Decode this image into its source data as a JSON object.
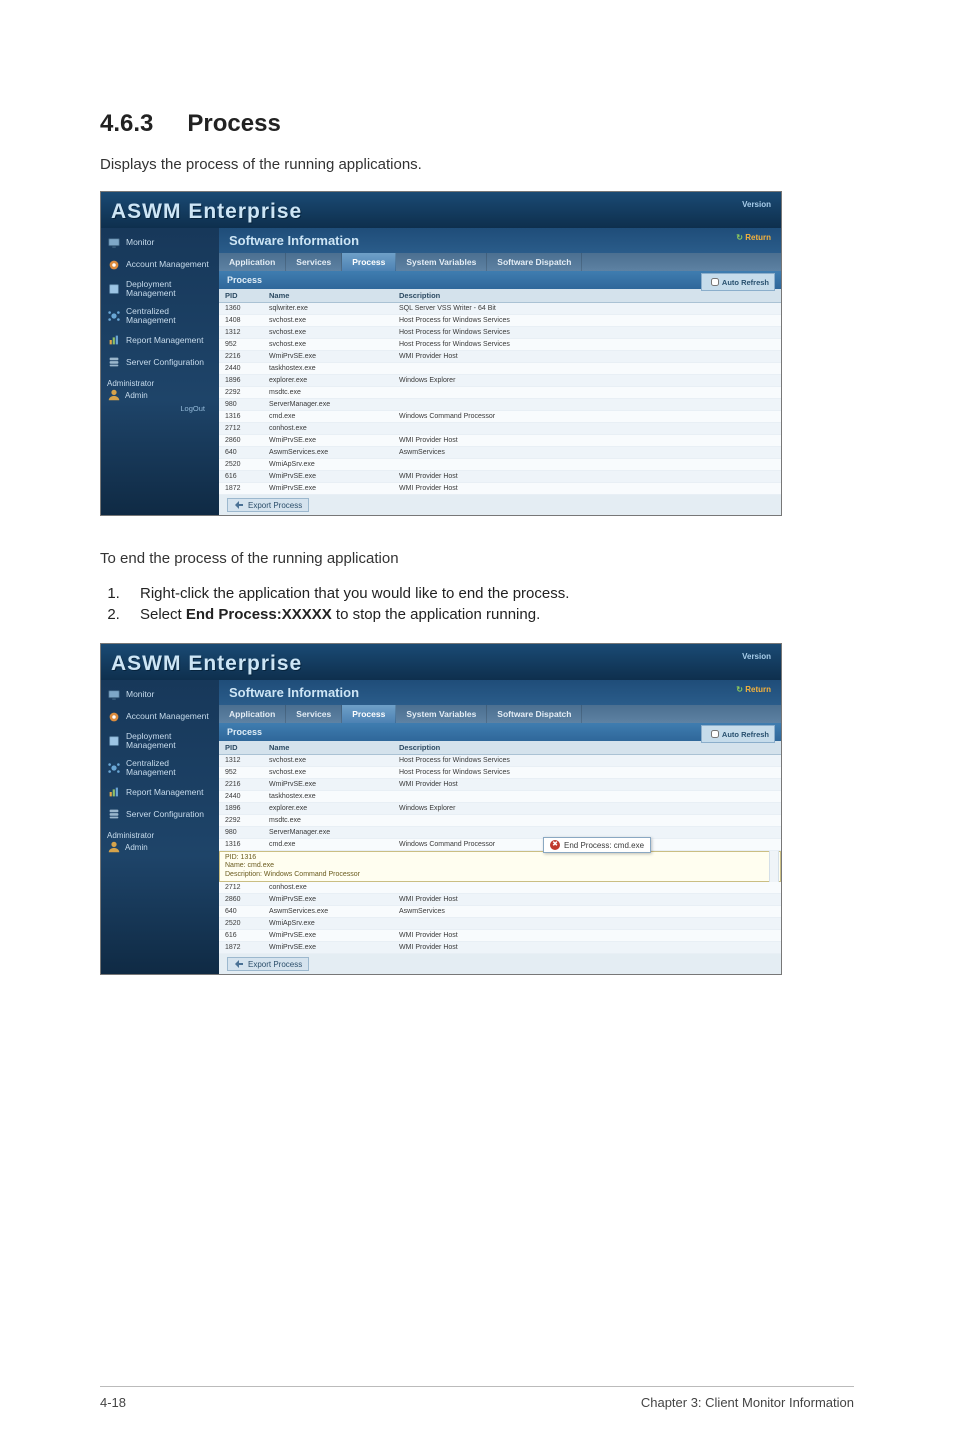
{
  "doc": {
    "section_number": "4.6.3",
    "section_title": "Process",
    "intro1": "Displays the process of the running applications.",
    "intro2": "To end the process of the running application",
    "step1": "Right-click the application that you would like to end the process.",
    "step2_a": "Select ",
    "step2_b": "End Process:XXXXX",
    "step2_c": " to stop the application running.",
    "page_left": "4-18",
    "page_right": "Chapter 3: Client Monitor Information"
  },
  "app": {
    "title": "ASWM Enterprise",
    "version_label": "Version",
    "main_section": "Software Information",
    "return_label": "Return",
    "tabs": {
      "application": "Application",
      "services": "Services",
      "process": "Process",
      "sysvars": "System Variables",
      "dispatch": "Software Dispatch"
    },
    "panel_title": "Process",
    "auto_refresh": "Auto Refresh",
    "headers": {
      "pid": "PID",
      "name": "Name",
      "desc": "Description"
    },
    "export_button": "Export Process",
    "nav": {
      "monitor": "Monitor",
      "account": "Account Management",
      "deploy": "Deployment Management",
      "central": "Centralized Management",
      "report": "Report Management",
      "server": "Server Configuration",
      "admin_label": "Administrator",
      "admin_user": "Admin",
      "logout": "LogOut"
    }
  },
  "shot1_rows": [
    {
      "pid": "1360",
      "name": "sqlwriter.exe",
      "desc": "SQL Server VSS Writer - 64 Bit"
    },
    {
      "pid": "1408",
      "name": "svchost.exe",
      "desc": "Host Process for Windows Services"
    },
    {
      "pid": "1312",
      "name": "svchost.exe",
      "desc": "Host Process for Windows Services"
    },
    {
      "pid": "952",
      "name": "svchost.exe",
      "desc": "Host Process for Windows Services"
    },
    {
      "pid": "2216",
      "name": "WmiPrvSE.exe",
      "desc": "WMI Provider Host"
    },
    {
      "pid": "2440",
      "name": "taskhostex.exe",
      "desc": ""
    },
    {
      "pid": "1896",
      "name": "explorer.exe",
      "desc": "Windows Explorer"
    },
    {
      "pid": "2292",
      "name": "msdtc.exe",
      "desc": ""
    },
    {
      "pid": "980",
      "name": "ServerManager.exe",
      "desc": ""
    },
    {
      "pid": "1316",
      "name": "cmd.exe",
      "desc": "Windows Command Processor"
    },
    {
      "pid": "2712",
      "name": "conhost.exe",
      "desc": ""
    },
    {
      "pid": "2860",
      "name": "WmiPrvSE.exe",
      "desc": "WMI Provider Host"
    },
    {
      "pid": "640",
      "name": "AswmServices.exe",
      "desc": "AswmServices"
    },
    {
      "pid": "2520",
      "name": "WmiApSrv.exe",
      "desc": ""
    },
    {
      "pid": "616",
      "name": "WmiPrvSE.exe",
      "desc": "WMI Provider Host"
    },
    {
      "pid": "1872",
      "name": "WmiPrvSE.exe",
      "desc": "WMI Provider Host"
    }
  ],
  "shot2_rows": [
    {
      "pid": "1312",
      "name": "svchost.exe",
      "desc": "Host Process for Windows Services"
    },
    {
      "pid": "952",
      "name": "svchost.exe",
      "desc": "Host Process for Windows Services"
    },
    {
      "pid": "2216",
      "name": "WmiPrvSE.exe",
      "desc": "WMI Provider Host"
    },
    {
      "pid": "2440",
      "name": "taskhostex.exe",
      "desc": ""
    },
    {
      "pid": "1896",
      "name": "explorer.exe",
      "desc": "Windows Explorer"
    },
    {
      "pid": "2292",
      "name": "msdtc.exe",
      "desc": ""
    },
    {
      "pid": "980",
      "name": "ServerManager.exe",
      "desc": ""
    },
    {
      "pid": "1316",
      "name": "cmd.exe",
      "desc": "Windows Command Processor"
    },
    {
      "pid": "2712",
      "name": "conhost.exe",
      "desc": ""
    },
    {
      "pid": "2860",
      "name": "WmiPrvSE.exe",
      "desc": "WMI Provider Host"
    },
    {
      "pid": "640",
      "name": "AswmServices.exe",
      "desc": "AswmServices"
    },
    {
      "pid": "2520",
      "name": "WmiApSrv.exe",
      "desc": ""
    },
    {
      "pid": "616",
      "name": "WmiPrvSE.exe",
      "desc": "WMI Provider Host"
    },
    {
      "pid": "1872",
      "name": "WmiPrvSE.exe",
      "desc": "WMI Provider Host"
    }
  ],
  "tooltip": {
    "line1": "PID: 1316",
    "line2": "Name: cmd.exe",
    "line3": "Description: Windows Command Processor"
  },
  "context_menu": {
    "label": "End Process: cmd.exe"
  }
}
